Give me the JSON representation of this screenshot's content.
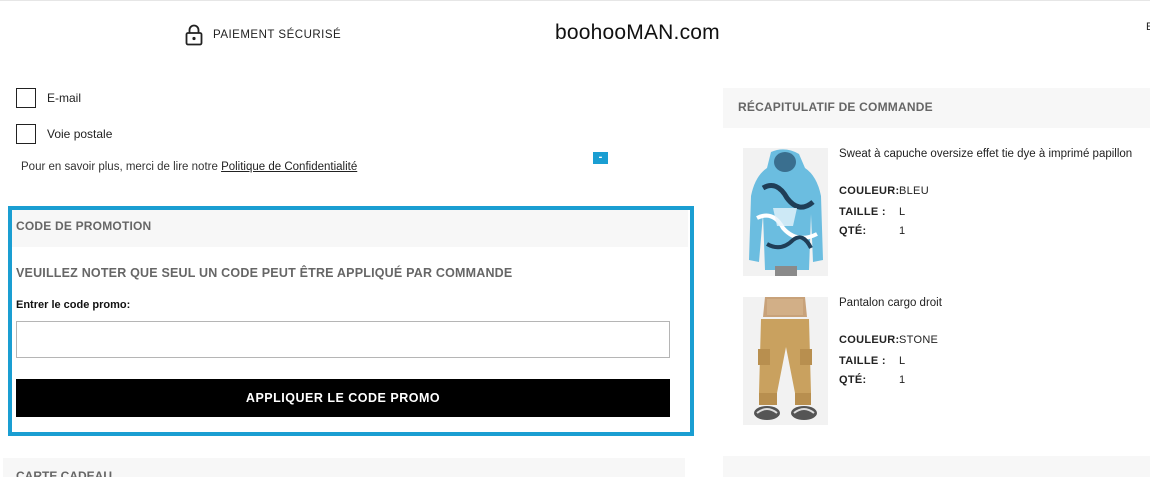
{
  "header": {
    "secure_label": "PAIEMENT SÉCURISÉ",
    "logo_text": "boohooMAN.com",
    "edge_text": "E"
  },
  "marketing": {
    "email_label": "E-mail",
    "post_label": "Voie postale",
    "privacy_text": "Pour en savoir plus, merci de lire notre ",
    "privacy_link": "Politique de Confidentialité",
    "collapse_symbol": "-"
  },
  "promo": {
    "title": "CODE DE PROMOTION",
    "note": "VEUILLEZ NOTER QUE SEUL UN CODE PEUT ÊTRE APPLIQUÉ PAR COMMANDE",
    "input_label": "Entrer le code promo:",
    "input_value": "",
    "button_label": "APPLIQUER LE CODE PROMO",
    "accent_color": "#1a9ed2"
  },
  "gift": {
    "title": "CARTE CADEAU"
  },
  "summary": {
    "title": "RÉCAPITULATIF DE COMMANDE",
    "items": [
      {
        "name": "Sweat à capuche oversize effet tie dye à imprimé papillon",
        "color_label": "COULEUR:",
        "color_value": "BLEU",
        "size_label": "TAILLE :",
        "size_value": "L",
        "qty_label": "QTÉ:",
        "qty_value": "1"
      },
      {
        "name": "Pantalon cargo droit",
        "color_label": "COULEUR:",
        "color_value": "STONE",
        "size_label": "TAILLE :",
        "size_value": "L",
        "qty_label": "QTÉ:",
        "qty_value": "1"
      }
    ]
  }
}
